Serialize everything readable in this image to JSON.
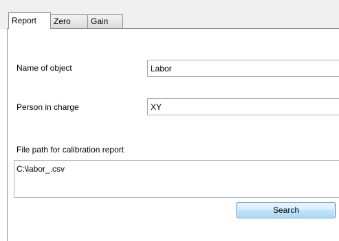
{
  "tabs": [
    {
      "label": "Report",
      "active": true
    },
    {
      "label": "Zero",
      "active": false
    },
    {
      "label": "Gain",
      "active": false
    }
  ],
  "report": {
    "object_name_label": "Name of object",
    "object_name_value": "Labor",
    "person_label": "Person in charge",
    "person_value": "XY",
    "file_path_label": "File path for calibration report",
    "file_path_value": "C:\\labor_.csv",
    "search_label": "Search"
  }
}
